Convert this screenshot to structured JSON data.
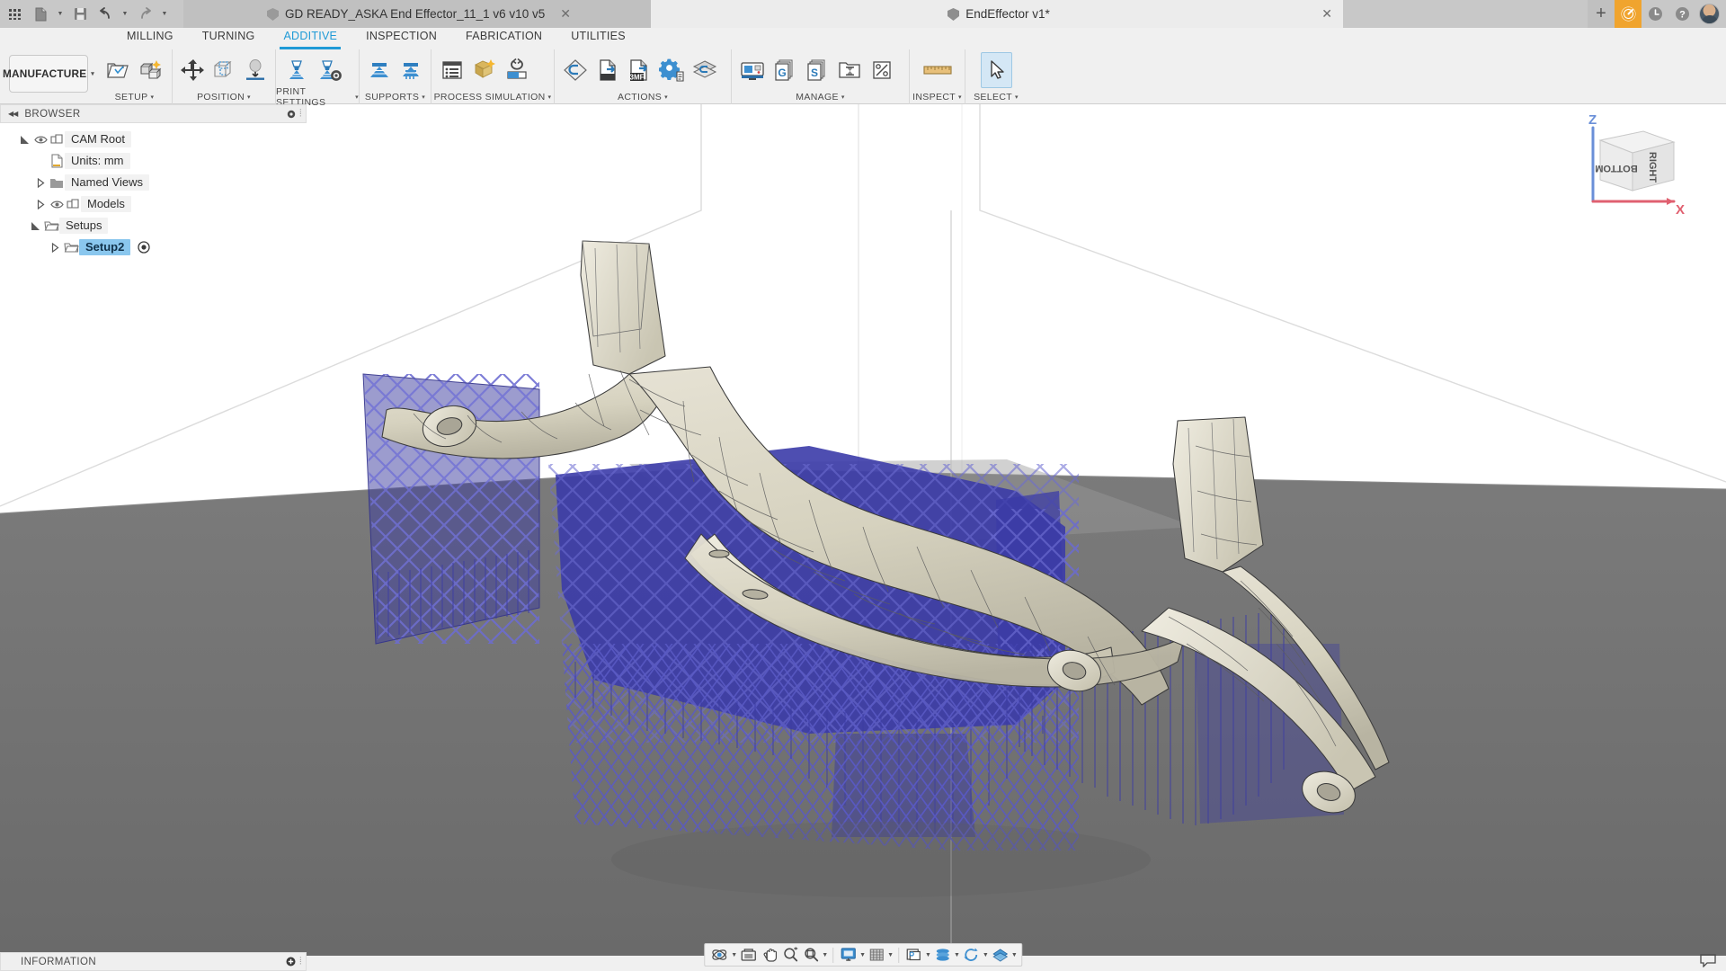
{
  "titlebar": {
    "quick_access": [
      {
        "name": "app-grid-icon",
        "label": "Apps"
      },
      {
        "name": "new-file-icon",
        "label": "New"
      },
      {
        "name": "save-icon",
        "label": "Save"
      },
      {
        "name": "undo-icon",
        "label": "Undo"
      },
      {
        "name": "redo-icon",
        "label": "Redo"
      }
    ],
    "tabs": [
      {
        "label": "GD READY_ASKA End Effector_11_1 v6 v10 v5",
        "active": false,
        "close": "✕"
      },
      {
        "label": "EndEffector v1*",
        "active": true,
        "close": "✕"
      }
    ],
    "new_tab_label": "+",
    "right_icons": [
      {
        "name": "extension-badge-icon",
        "label": ""
      },
      {
        "name": "job-status-clock-icon",
        "label": ""
      },
      {
        "name": "help-icon",
        "label": "?"
      }
    ]
  },
  "ribbon": {
    "workspace_button": "MANUFACTURE",
    "workspace_caret": "▾",
    "tabs": [
      {
        "label": "MILLING",
        "active": false
      },
      {
        "label": "TURNING",
        "active": false
      },
      {
        "label": "ADDITIVE",
        "active": true
      },
      {
        "label": "INSPECTION",
        "active": false
      },
      {
        "label": "FABRICATION",
        "active": false
      },
      {
        "label": "UTILITIES",
        "active": false
      }
    ],
    "panels": [
      {
        "label": "SETUP",
        "caret": "▾",
        "icons": [
          {
            "name": "new-setup-icon"
          },
          {
            "name": "manual-nc-icon"
          }
        ]
      },
      {
        "label": "POSITION",
        "caret": "▾",
        "icons": [
          {
            "name": "move-icon"
          },
          {
            "name": "automatic-orientation-icon"
          },
          {
            "name": "place-on-platform-icon"
          }
        ]
      },
      {
        "label": "PRINT SETTINGS",
        "caret": "▾",
        "icons": [
          {
            "name": "print-settings-icon"
          },
          {
            "name": "print-settings-edit-icon"
          }
        ]
      },
      {
        "label": "SUPPORTS",
        "caret": "▾",
        "icons": [
          {
            "name": "volume-support-icon"
          },
          {
            "name": "bar-support-icon"
          }
        ]
      },
      {
        "label": "PROCESS SIMULATION",
        "caret": "▾",
        "icons": [
          {
            "name": "simulation-setup-icon"
          },
          {
            "name": "compensate-icon"
          },
          {
            "name": "simulation-compare-icon"
          }
        ]
      },
      {
        "label": "ACTIONS",
        "caret": "▾",
        "icons": [
          {
            "name": "generate-toolpath-icon"
          },
          {
            "name": "export-icon"
          },
          {
            "name": "export-3mf-icon"
          },
          {
            "name": "post-process-icon"
          },
          {
            "name": "slice-preview-icon"
          }
        ]
      },
      {
        "label": "MANAGE",
        "caret": "▾",
        "icons": [
          {
            "name": "machine-library-icon"
          },
          {
            "name": "generic-print-setting-library-icon"
          },
          {
            "name": "print-setting-library-icon"
          },
          {
            "name": "job-status-icon"
          },
          {
            "name": "tolerance-icon"
          }
        ]
      },
      {
        "label": "INSPECT",
        "caret": "▾",
        "icons": [
          {
            "name": "measure-icon"
          }
        ]
      },
      {
        "label": "SELECT",
        "caret": "▾",
        "icons": [
          {
            "name": "select-cursor-icon",
            "selected": true
          }
        ]
      }
    ]
  },
  "browser": {
    "title": "BROWSER",
    "collapse_icon": "◀◀",
    "tree": [
      {
        "label": "CAM Root",
        "depth": 0,
        "expander": "open",
        "eye": true,
        "icon": "cam-root-icon",
        "highlight": false
      },
      {
        "label": "Units: mm",
        "depth": 1,
        "expander": "none",
        "eye": false,
        "icon": "document-units-icon",
        "highlight": false
      },
      {
        "label": "Named Views",
        "depth": 1,
        "expander": "closed",
        "eye": false,
        "icon": "folder-icon",
        "highlight": false
      },
      {
        "label": "Models",
        "depth": 1,
        "expander": "closed",
        "eye": true,
        "icon": "models-icon",
        "highlight": false
      },
      {
        "label": "Setups",
        "depth": 0,
        "expander": "open",
        "eye": false,
        "icon": "setups-folder-icon",
        "highlight": false
      },
      {
        "label": "Setup2",
        "depth": 1,
        "expander": "closed",
        "eye": false,
        "icon": "setup-folder-icon",
        "highlight": true,
        "target_icon": true
      }
    ]
  },
  "viewcube": {
    "face_front": "BOTTOM",
    "face_right": "RIGHT",
    "axis_z": "Z",
    "axis_x": "X",
    "z_color": "#6a8fd8",
    "x_color": "#e06070"
  },
  "statusbar": {
    "information_label": "INFORMATION",
    "nav_icons": [
      {
        "name": "orbit-icon",
        "caret": true
      },
      {
        "name": "look-at-icon",
        "caret": false
      },
      {
        "name": "pan-icon",
        "caret": false
      },
      {
        "name": "zoom-icon",
        "caret": false
      },
      {
        "name": "fit-icon",
        "caret": true
      },
      {
        "name": "display-settings-icon",
        "caret": true
      },
      {
        "name": "grid-snaps-icon",
        "caret": true
      },
      {
        "name": "viewports-icon",
        "caret": true
      },
      {
        "name": "component-color-cycling-icon",
        "caret": true
      },
      {
        "name": "refresh-icon",
        "caret": true
      },
      {
        "name": "object-visibility-icon",
        "caret": true
      }
    ],
    "comment_icon": "comment-icon"
  },
  "colors": {
    "accent": "#1f9ad6",
    "support_blue": "#3b3ba0",
    "part_beige": "#d9d5c3",
    "platform_gray": "#6e6e6e",
    "backdrop": "#ffffff",
    "titlebar": "#c8c8c8",
    "highlight": "#8ac7ee",
    "orange_badge": "#f0a42e"
  }
}
